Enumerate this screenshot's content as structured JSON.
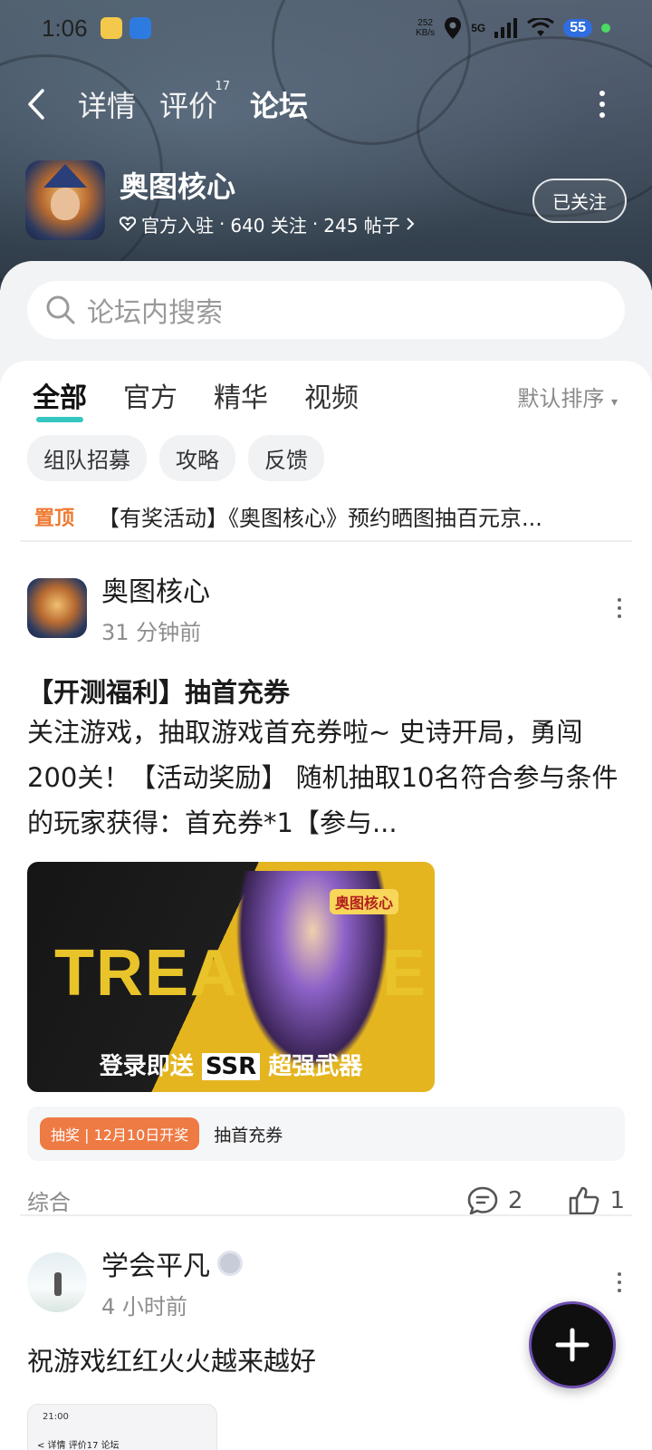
{
  "status_bar": {
    "time": "1:06",
    "net_speed_value": "252",
    "net_speed_unit": "KB/s",
    "network": "5G",
    "battery": "55"
  },
  "nav": {
    "tabs": [
      {
        "label": "详情"
      },
      {
        "label": "评价",
        "count": "17"
      },
      {
        "label": "论坛"
      }
    ],
    "active": "论坛"
  },
  "game": {
    "name": "奥图核心",
    "official": "官方入驻",
    "followers": "640 关注",
    "posts": "245 帖子",
    "follow_button": "已关注"
  },
  "search": {
    "placeholder": "论坛内搜索"
  },
  "feed_tabs": [
    "全部",
    "官方",
    "精华",
    "视频"
  ],
  "sort_label": "默认排序",
  "chips": [
    "组队招募",
    "攻略",
    "反馈"
  ],
  "pinned": {
    "tag": "置顶",
    "text": "【有奖活动】《奥图核心》预约晒图抽百元京..."
  },
  "posts": [
    {
      "author": "奥图核心",
      "time": "31 分钟前",
      "title": "【开测福利】抽首充券",
      "body": "关注游戏，抽取游戏首充券啦~ 史诗开局，勇闯200关！【活动奖励】 随机抽取10名符合参与条件的玩家获得：首充券*1【参与...",
      "image_title": "TREASURE",
      "image_logo": "奥图核心",
      "image_caption_pre": "登录即送",
      "image_caption_ssr": "SSR",
      "image_caption_post": "超强武器",
      "lottery_badge": "抽奖 | 12月10日开奖",
      "lottery_text": "抽首充券",
      "category": "综合",
      "comments": "2",
      "likes": "1"
    },
    {
      "author": "学会平凡",
      "time": "4 小时前",
      "body": "祝游戏红红火火越来越好",
      "thumb_time": "21:00",
      "thumb_nav": "< 详情  评价17  论坛"
    }
  ],
  "colors": {
    "accent": "#36c6c0",
    "pinned_tag": "#ef7a33",
    "lottery_badge": "#ee7a44"
  },
  "icons": [
    "back-arrow-icon",
    "more-vertical-icon",
    "heart-badge-icon",
    "search-icon",
    "comment-icon",
    "thumbs-up-icon",
    "plus-icon"
  ]
}
